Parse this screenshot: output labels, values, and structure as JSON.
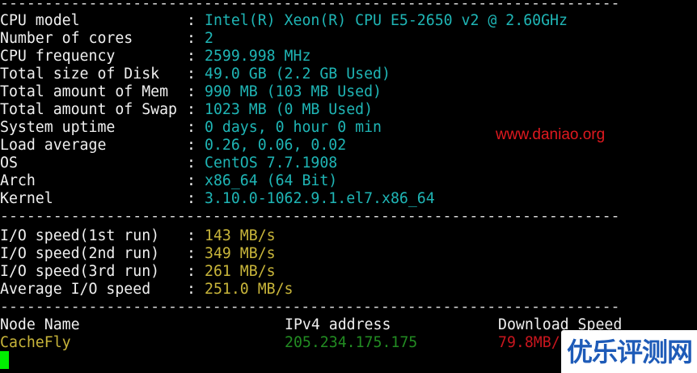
{
  "separator": "----------------------------------------------------------------------",
  "colon": ":",
  "system_info": [
    {
      "label": "CPU model",
      "value": "Intel(R) Xeon(R) CPU E5-2650 v2 @ 2.60GHz"
    },
    {
      "label": "Number of cores",
      "value": "2"
    },
    {
      "label": "CPU frequency",
      "value": "2599.998 MHz"
    },
    {
      "label": "Total size of Disk",
      "value": "49.0 GB (2.2 GB Used)"
    },
    {
      "label": "Total amount of Mem",
      "value": "990 MB (103 MB Used)"
    },
    {
      "label": "Total amount of Swap",
      "value": "1023 MB (0 MB Used)"
    },
    {
      "label": "System uptime",
      "value": "0 days, 0 hour 0 min"
    },
    {
      "label": "Load average",
      "value": "0.26, 0.06, 0.02"
    },
    {
      "label": "OS",
      "value": "CentOS 7.7.1908"
    },
    {
      "label": "Arch",
      "value": "x86_64 (64 Bit)"
    },
    {
      "label": "Kernel",
      "value": "3.10.0-1062.9.1.el7.x86_64"
    }
  ],
  "io_speed": [
    {
      "label": "I/O speed(1st run)",
      "value": "143 MB/s"
    },
    {
      "label": "I/O speed(2nd run)",
      "value": "349 MB/s"
    },
    {
      "label": "I/O speed(3rd run)",
      "value": "261 MB/s"
    },
    {
      "label": "Average I/O speed",
      "value": "251.0 MB/s"
    }
  ],
  "network": {
    "headers": {
      "node": "Node Name",
      "ip": "IPv4 address",
      "download": "Download Speed"
    },
    "rows": [
      {
        "node": "CacheFly",
        "ip": "205.234.175.175",
        "download": "79.8MB/s"
      }
    ]
  },
  "watermark": "www.daniao.org",
  "badge_text": "优乐评测网",
  "colors": {
    "background": "#000000",
    "label": "#f0f0f0",
    "info_value": "#1fb5b5",
    "io_value": "#c8b53a",
    "node_name": "#c8b53a",
    "ip": "#228b22",
    "download": "#c8161e",
    "watermark": "#e0191f",
    "cursor": "#00ee00",
    "badge_text": "#1e5bb8"
  }
}
